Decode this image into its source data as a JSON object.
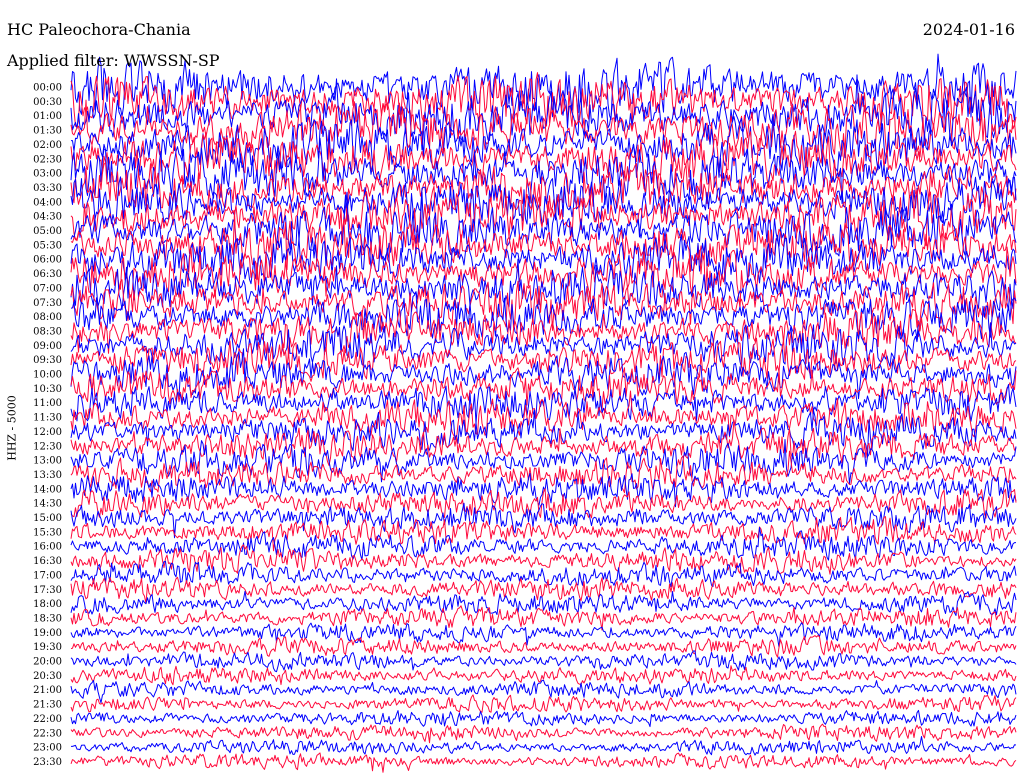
{
  "header": {
    "station": "HC Paleochora-Chania",
    "date": "2024-01-16",
    "filter": "Applied filter: WWSSN-SP"
  },
  "channel": "HHZ - 5000",
  "colors": {
    "trace_a": "#0000ff",
    "trace_b": "#ff0a3c",
    "background": "#ffffff"
  },
  "chart_data": {
    "type": "line",
    "subtype": "helicorder",
    "rows": [
      {
        "label": "00:00",
        "amplitude": 1.0
      },
      {
        "label": "00:30",
        "amplitude": 1.0
      },
      {
        "label": "01:00",
        "amplitude": 0.98
      },
      {
        "label": "01:30",
        "amplitude": 0.98
      },
      {
        "label": "02:00",
        "amplitude": 0.97
      },
      {
        "label": "02:30",
        "amplitude": 0.97
      },
      {
        "label": "03:00",
        "amplitude": 0.96
      },
      {
        "label": "03:30",
        "amplitude": 0.95
      },
      {
        "label": "04:00",
        "amplitude": 0.94
      },
      {
        "label": "04:30",
        "amplitude": 0.93
      },
      {
        "label": "05:00",
        "amplitude": 0.92
      },
      {
        "label": "05:30",
        "amplitude": 0.9
      },
      {
        "label": "06:00",
        "amplitude": 0.88
      },
      {
        "label": "06:30",
        "amplitude": 0.86
      },
      {
        "label": "07:00",
        "amplitude": 0.84
      },
      {
        "label": "07:30",
        "amplitude": 0.82
      },
      {
        "label": "08:00",
        "amplitude": 0.8
      },
      {
        "label": "08:30",
        "amplitude": 0.78
      },
      {
        "label": "09:00",
        "amplitude": 0.76
      },
      {
        "label": "09:30",
        "amplitude": 0.74
      },
      {
        "label": "10:00",
        "amplitude": 0.72
      },
      {
        "label": "10:30",
        "amplitude": 0.7
      },
      {
        "label": "11:00",
        "amplitude": 0.68
      },
      {
        "label": "11:30",
        "amplitude": 0.66
      },
      {
        "label": "12:00",
        "amplitude": 0.64
      },
      {
        "label": "12:30",
        "amplitude": 0.62
      },
      {
        "label": "13:00",
        "amplitude": 0.6
      },
      {
        "label": "13:30",
        "amplitude": 0.58
      },
      {
        "label": "14:00",
        "amplitude": 0.56
      },
      {
        "label": "14:30",
        "amplitude": 0.54
      },
      {
        "label": "15:00",
        "amplitude": 0.52
      },
      {
        "label": "15:30",
        "amplitude": 0.5
      },
      {
        "label": "16:00",
        "amplitude": 0.48
      },
      {
        "label": "16:30",
        "amplitude": 0.46
      },
      {
        "label": "17:00",
        "amplitude": 0.44
      },
      {
        "label": "17:30",
        "amplitude": 0.42
      },
      {
        "label": "18:00",
        "amplitude": 0.4
      },
      {
        "label": "18:30",
        "amplitude": 0.38
      },
      {
        "label": "19:00",
        "amplitude": 0.36
      },
      {
        "label": "19:30",
        "amplitude": 0.35
      },
      {
        "label": "20:00",
        "amplitude": 0.34
      },
      {
        "label": "20:30",
        "amplitude": 0.33
      },
      {
        "label": "21:00",
        "amplitude": 0.32
      },
      {
        "label": "21:30",
        "amplitude": 0.31
      },
      {
        "label": "22:00",
        "amplitude": 0.3
      },
      {
        "label": "22:30",
        "amplitude": 0.3
      },
      {
        "label": "23:00",
        "amplitude": 0.29
      },
      {
        "label": "23:30",
        "amplitude": 0.29
      }
    ],
    "row_colors": [
      "#0000ff",
      "#ff0a3c"
    ],
    "grid": false,
    "legend": "none"
  }
}
